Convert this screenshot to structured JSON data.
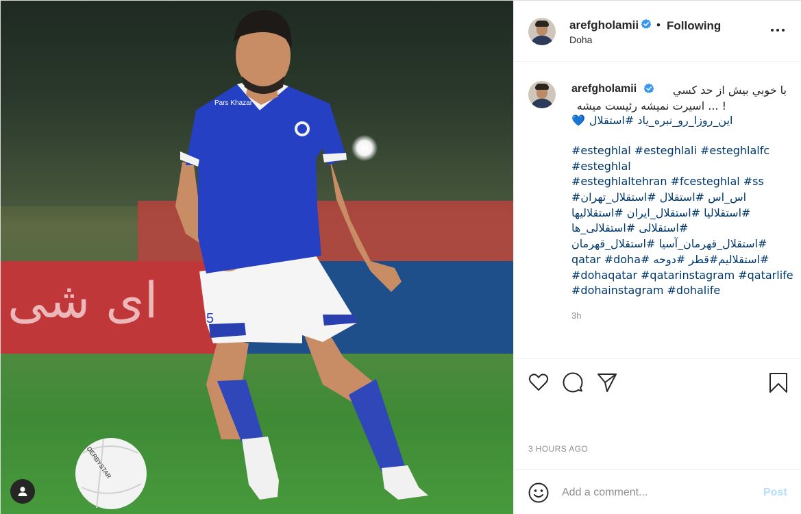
{
  "post": {
    "username": "arefgholamii",
    "follow_status": "Following",
    "separator": "•",
    "location": "Doha",
    "caption_lines": [
      "با خوبي بيش از حد كسي",
      "! ... اسيرت نميشه رئيست ميشه",
      "اين_روزا_رو_نبره_ياد #استقلال"
    ],
    "heart_emoji": "💙",
    "hashtag_lines": [
      "#esteghlal #esteghlali #esteghlalfc",
      "#esteghlal",
      "#esteghlaltehran #fcesteghlal #ss",
      "اس_اس #استقلال #استقلال_تهران#",
      "#استقلاليا #استقلال_ايران #استقلاليها",
      "#استقلالى #استقلالى_ها",
      "#استقلال_قهرمان_آسيا #استقلال_قهرمان",
      "#استقلاليم#قطر #دوحه #qatar #doha",
      "#dohaqatar #qatarinstagram #qatarlife",
      "#dohainstagram #dohalife"
    ],
    "relative_time": "3h",
    "timestamp": "3 HOURS AGO"
  },
  "comment": {
    "placeholder": "Add a comment...",
    "post_label": "Post"
  },
  "photo": {
    "ad_text": "ای شی",
    "shirt_sponsor": "Pars Khazar",
    "shirt_number": "5",
    "ball_text": "DERBYSTAR"
  },
  "colors": {
    "verified": "#3897f0",
    "hashtag": "#00376b",
    "post_disabled": "#b2dffc",
    "muted": "#8e8e8e"
  },
  "icons": [
    "verified-badge-icon",
    "more-options-icon",
    "heart-icon",
    "comment-icon",
    "share-icon",
    "bookmark-icon",
    "emoji-icon",
    "user-tag-icon"
  ]
}
